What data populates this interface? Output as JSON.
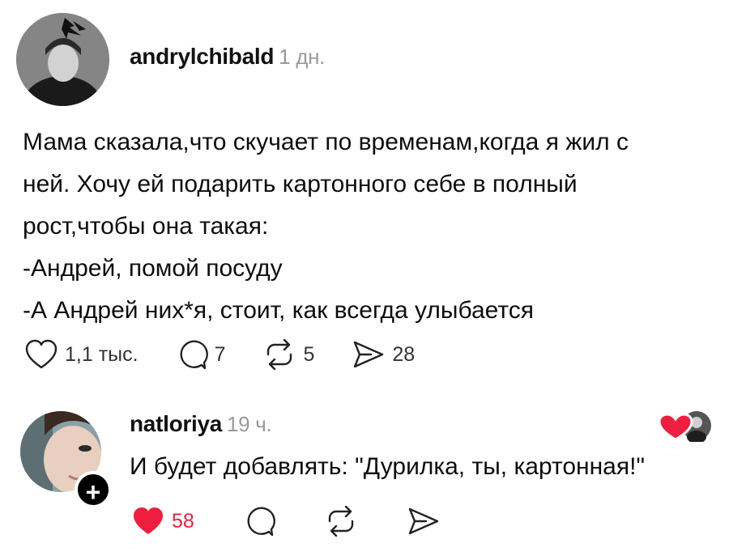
{
  "post": {
    "username": "andrylchibald",
    "time": "1 дн.",
    "lines": [
      "Мама сказала,что скучает по временам,когда я жил с",
      "ней. Хочу ей подарить картонного себе в полный",
      "рост,чтобы она такая:",
      "-Андрей, помой посуду",
      "-А Андрей них*я, стоит, как всегда улыбается"
    ],
    "likes": "1,1 тыс.",
    "comments": "7",
    "reposts": "5",
    "shares": "28"
  },
  "reply": {
    "username": "natloriya",
    "time": "19 ч.",
    "text": "И будет добавлять: \"Дурилка, ты, картонная!\"",
    "likes": "58",
    "follow_badge": "+"
  },
  "colors": {
    "like_red": "#ee1f3e",
    "muted": "#9a9a9a"
  }
}
